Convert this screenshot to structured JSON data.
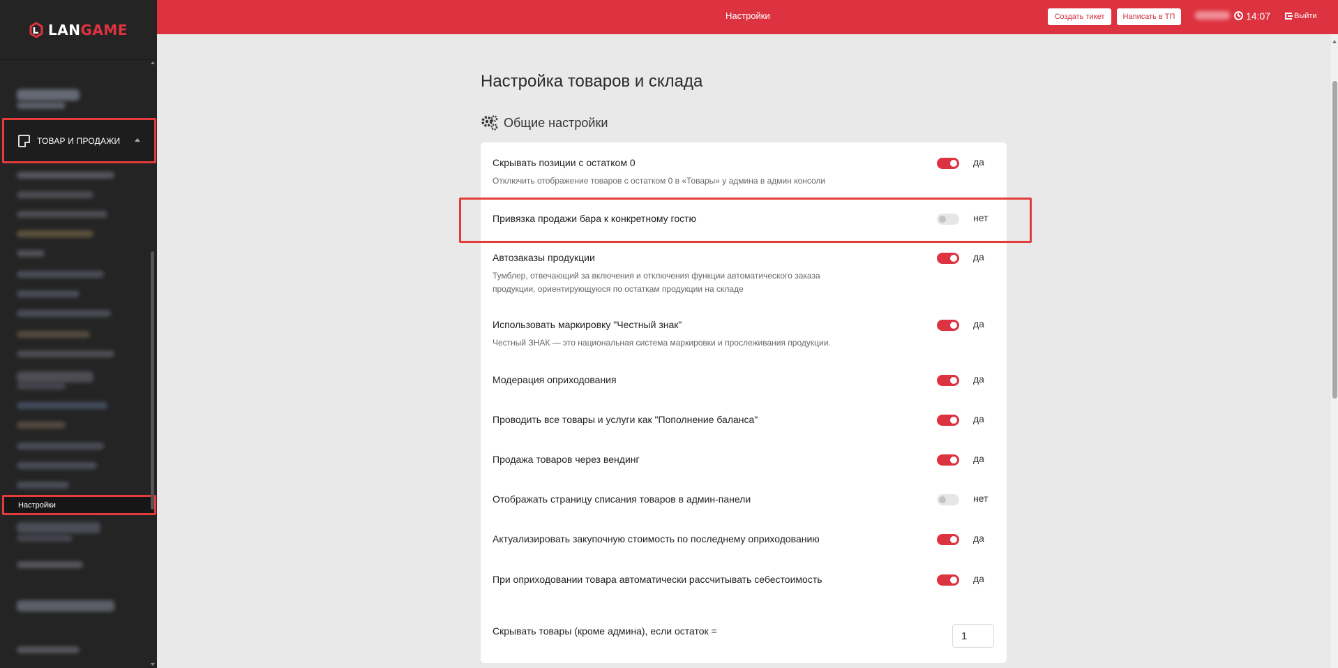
{
  "app": {
    "logo_text_a": "LAN",
    "logo_text_b": "GAME"
  },
  "sidebar": {
    "section_label": "ТОВАР И ПРОДАЖИ",
    "active_item": "Настройки"
  },
  "header": {
    "title": "Настройки",
    "create_ticket": "Создать тикет",
    "write_support": "Написать в ТП",
    "time": "14:07",
    "logout": "Выйти"
  },
  "page": {
    "title": "Настройка товаров и склада",
    "section": "Общие настройки"
  },
  "settings": [
    {
      "title": "Скрывать позиции с остатком 0",
      "desc": "Отключить отображение товаров с остатком 0 в «Товары» у админа в админ консоли",
      "on": true,
      "state": "да"
    },
    {
      "title": "Привязка продажи бара к конкретному гостю",
      "desc": "",
      "on": false,
      "state": "нет"
    },
    {
      "title": "Автозаказы продукции",
      "desc": "Тумблер, отвечающий за включения и отключения функции автоматического заказа продукции, ориентирующуюся по остаткам продукции на складе",
      "on": true,
      "state": "да"
    },
    {
      "title": "Использовать маркировку \"Честный знак\"",
      "desc": "Честный ЗНАК — это национальная система маркировки и прослеживания продукции.",
      "on": true,
      "state": "да"
    },
    {
      "title": "Модерация оприходования",
      "desc": "",
      "on": true,
      "state": "да"
    },
    {
      "title": "Проводить все товары и услуги как \"Пополнение баланса\"",
      "desc": "",
      "on": true,
      "state": "да"
    },
    {
      "title": "Продажа товаров через вендинг",
      "desc": "",
      "on": true,
      "state": "да"
    },
    {
      "title": "Отображать страницу списания товаров в админ-панели",
      "desc": "",
      "on": false,
      "state": "нет"
    },
    {
      "title": "Актуализировать закупочную стоимость по последнему оприходованию",
      "desc": "",
      "on": true,
      "state": "да"
    },
    {
      "title": "При оприходовании товара автоматически рассчитывать себестоимость",
      "desc": "",
      "on": true,
      "state": "да"
    }
  ],
  "hide_threshold": {
    "title": "Скрывать товары (кроме админа), если остаток =",
    "value": "1"
  },
  "colors": {
    "accent": "#dd3240",
    "sidebar": "#242424",
    "highlight": "#e53b3b"
  }
}
